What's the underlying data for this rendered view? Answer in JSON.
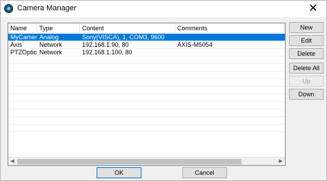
{
  "window": {
    "title": "Camera Manager",
    "close_glyph": "✕"
  },
  "list": {
    "columns": [
      "Name",
      "Type",
      "Content",
      "Comments"
    ],
    "rows": [
      {
        "name": "MyCamera",
        "type": "Analog",
        "content": "Sony(VISCA), 1, COM3, 9600",
        "comments": "",
        "selected": true
      },
      {
        "name": "Axis",
        "type": "Network",
        "content": "192.168.1.90, 80",
        "comments": "AXIS-M5054",
        "selected": false
      },
      {
        "name": "PTZOptics",
        "type": "Network",
        "content": "192.168.1.100, 80",
        "comments": "",
        "selected": false
      }
    ],
    "empty_rows": 10,
    "scroll_left_glyph": "◀",
    "scroll_right_glyph": "▶"
  },
  "side_buttons": {
    "new": "New",
    "edit": "Edit",
    "delete": "Delete",
    "delete_all": "Delete All",
    "up": "Up",
    "down": "Down"
  },
  "footer_buttons": {
    "ok": "OK",
    "cancel": "Cancel"
  },
  "colors": {
    "selection": "#0078d7",
    "window_bg": "#f0f0f0"
  },
  "icons": {
    "app": "camera-lens-icon",
    "close": "close-icon"
  }
}
